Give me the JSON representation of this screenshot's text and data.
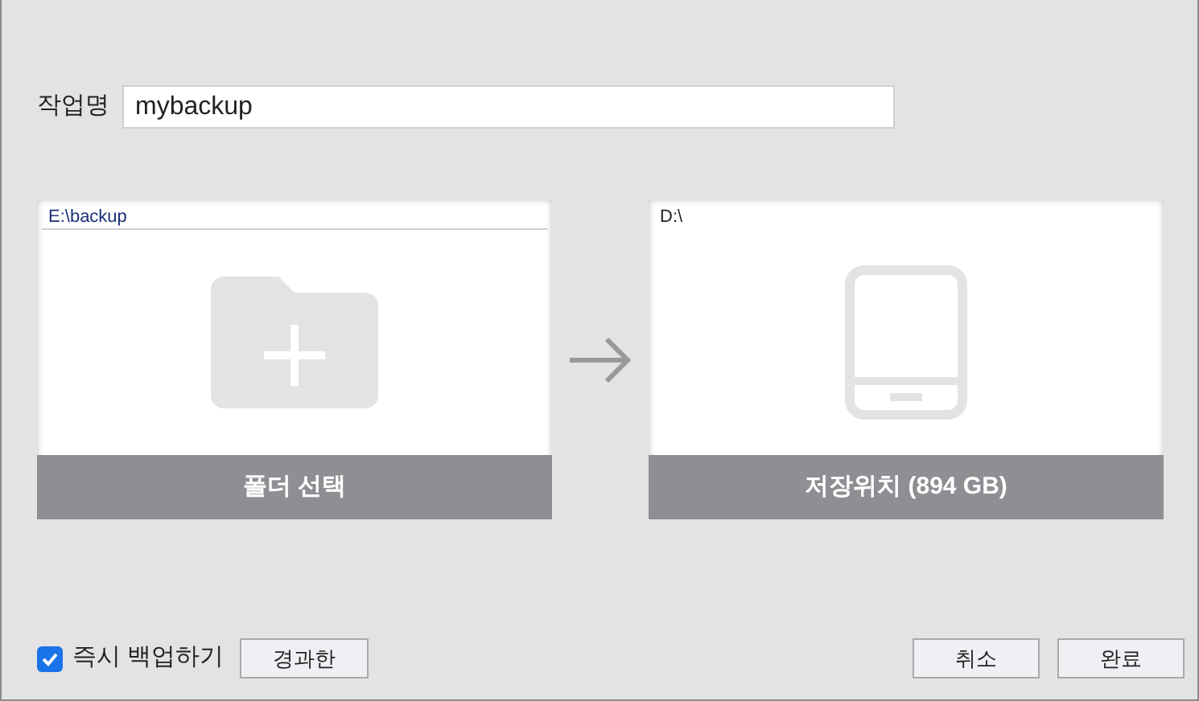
{
  "job_name": {
    "label": "작업명",
    "value": "mybackup"
  },
  "source": {
    "path": "E:\\backup",
    "button": "폴더 선택"
  },
  "target": {
    "path": "D:\\",
    "button": "저장위치 (894 GB)"
  },
  "instant_backup": {
    "label": "즉시 백업하기",
    "checked": true
  },
  "elapsed_button": "경과한",
  "buttons": [
    "취소",
    "완료"
  ]
}
